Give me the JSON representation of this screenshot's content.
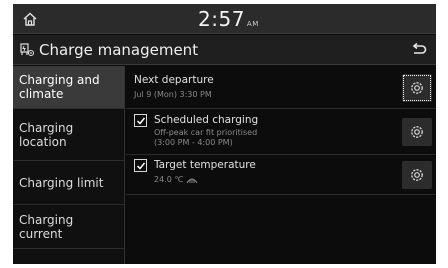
{
  "status_bar": {
    "time": "2:57",
    "ampm": "AM"
  },
  "header": {
    "title": "Charge management"
  },
  "menu": {
    "items": [
      {
        "line1": "Charging and",
        "line2": "climate"
      },
      {
        "line1": "Charging",
        "line2": "location"
      },
      {
        "line1": "Charging limit",
        "line2": ""
      },
      {
        "line1": "Charging",
        "line2": "current"
      }
    ]
  },
  "content": {
    "next_departure": {
      "title": "Next departure",
      "detail": "Jul 9 (Mon) 3:30 PM"
    },
    "scheduled_charging": {
      "title": "Scheduled charging",
      "detail_line1": "Off-peak car fit prioritised",
      "detail_line2": "(3:00 PM - 4:00 PM)",
      "checked": true
    },
    "target_temperature": {
      "title": "Target temperature",
      "detail": "24.0 ℃",
      "checked": true
    }
  },
  "colors": {
    "background": "#0c0c0c",
    "active_menu": "#3a3a3a",
    "statusbar": "#2b2b2b"
  }
}
